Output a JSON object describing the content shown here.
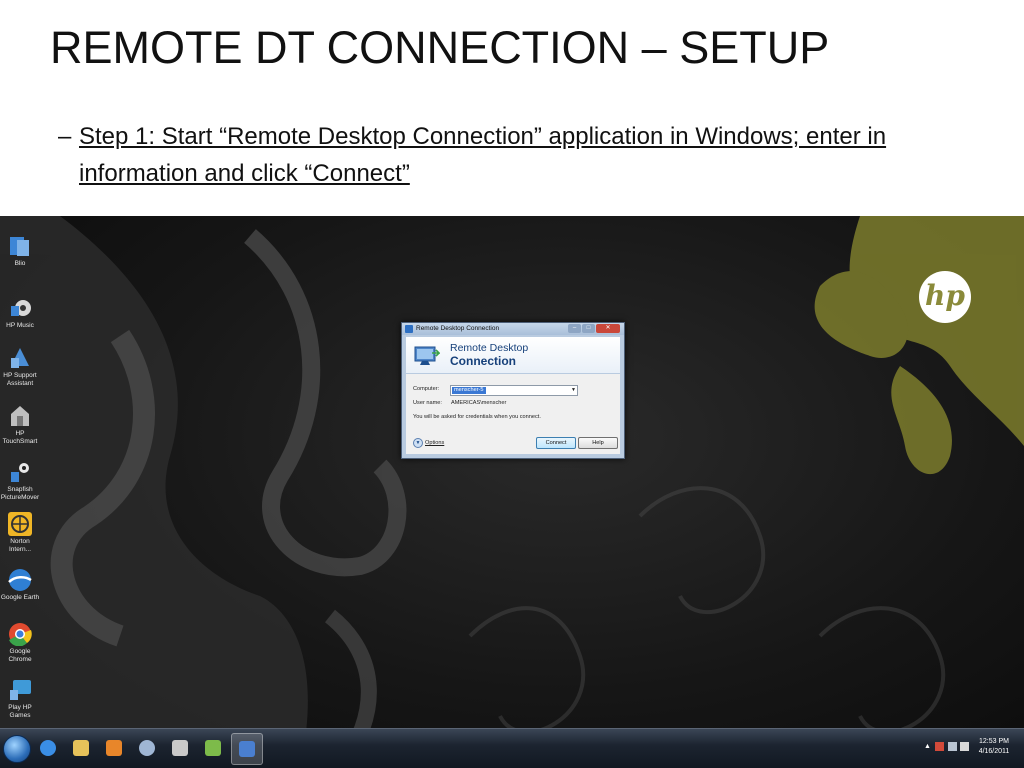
{
  "slide": {
    "title": "REMOTE DT CONNECTION – SETUP",
    "bullet_dash": "–",
    "bullet_text": "Step 1:  Start “Remote Desktop Connection” application in Windows; enter in information and click “Connect”"
  },
  "desktop": {
    "icons": [
      {
        "label": "Blio",
        "icon": "blio-icon",
        "color": "#3d86d6"
      },
      {
        "label": "HP Music",
        "icon": "hp-music-icon",
        "color": "#d8d8d8"
      },
      {
        "label": "HP Support Assistant",
        "icon": "hp-support-icon",
        "color": "#4a8ed6"
      },
      {
        "label": "HP TouchSmart",
        "icon": "hp-touchsmart-icon",
        "color": "#bfbfbf"
      },
      {
        "label": "Snapfish PictureMover",
        "icon": "snapfish-icon",
        "color": "#e8e8e8"
      },
      {
        "label": "Norton Intern...",
        "icon": "norton-icon",
        "color": "#f0b626"
      },
      {
        "label": "Google Earth",
        "icon": "google-earth-icon",
        "color": "#2f7fd3"
      },
      {
        "label": "Google Chrome",
        "icon": "chrome-icon",
        "color": "#e04a2f"
      },
      {
        "label": "Play HP Games",
        "icon": "hp-games-icon",
        "color": "#3f9ad8"
      }
    ],
    "brand_logo": "hp",
    "logo_color": "#8a8a3a"
  },
  "dialog": {
    "window_title": "Remote Desktop Connection",
    "banner_line1": "Remote Desktop",
    "banner_line2": "Connection",
    "computer_label": "Computer:",
    "computer_value": "menscher-5",
    "username_label": "User name:",
    "username_value": "AMERICAS\\menscher",
    "note": "You will be asked for credentials when you connect.",
    "options_label": "Options",
    "connect_label": "Connect",
    "help_label": "Help"
  },
  "taskbar": {
    "pinned": [
      {
        "name": "internet-explorer",
        "icon": "internet-explorer-icon",
        "color": "#3a8ee6"
      },
      {
        "name": "file-explorer",
        "icon": "folder-icon",
        "color": "#e6c25a"
      },
      {
        "name": "media-player",
        "icon": "media-player-icon",
        "color": "#e8862a"
      },
      {
        "name": "network-tool",
        "icon": "network-icon",
        "color": "#9fb6d4"
      },
      {
        "name": "hp-app",
        "icon": "hp-app-icon",
        "color": "#c9c9c9"
      },
      {
        "name": "photo-app",
        "icon": "photo-icon",
        "color": "#7dbb4a"
      },
      {
        "name": "remote-desktop",
        "icon": "remote-desktop-icon",
        "color": "#4a7fd0",
        "active": true
      }
    ],
    "tray_arrow": "▲",
    "clock_time": "12:53 PM",
    "clock_date": "4/16/2011"
  }
}
